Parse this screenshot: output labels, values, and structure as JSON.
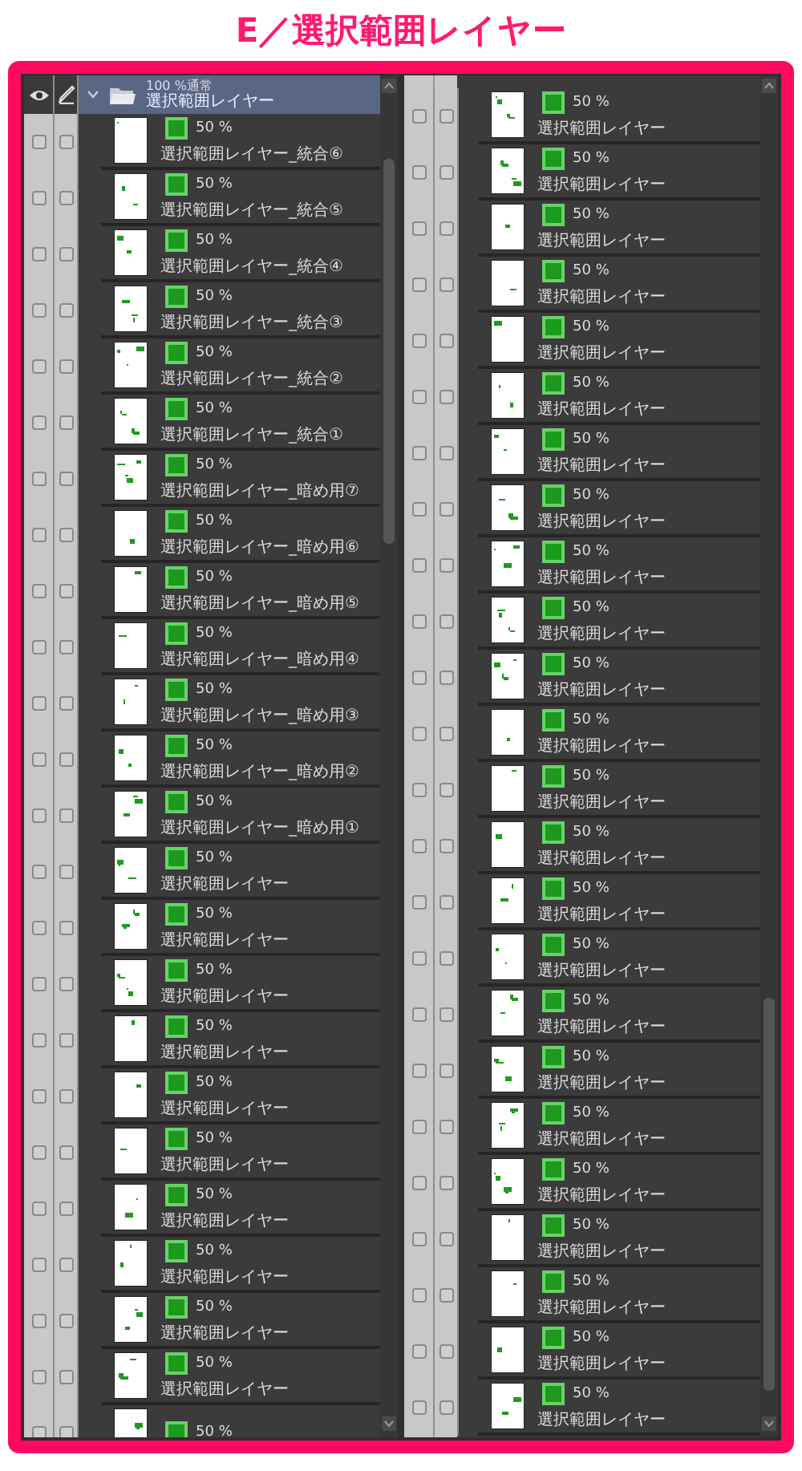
{
  "title": "E／選択範囲レイヤー",
  "panels": [
    {
      "folder": {
        "mode": "100 %通常",
        "name": "選択範囲レイヤー",
        "expanded": true,
        "selected": true
      },
      "layers": [
        {
          "percent": "50 %",
          "name": "選択範囲レイヤー_統合⑥",
          "visible": false,
          "pen": false,
          "selected": false
        },
        {
          "percent": "50 %",
          "name": "選択範囲レイヤー_統合⑤",
          "visible": false,
          "pen": false,
          "selected": false
        },
        {
          "percent": "50 %",
          "name": "選択範囲レイヤー_統合④",
          "visible": false,
          "pen": false,
          "selected": false
        },
        {
          "percent": "50 %",
          "name": "選択範囲レイヤー_統合③",
          "visible": false,
          "pen": false,
          "selected": false
        },
        {
          "percent": "50 %",
          "name": "選択範囲レイヤー_統合②",
          "visible": false,
          "pen": false,
          "selected": false
        },
        {
          "percent": "50 %",
          "name": "選択範囲レイヤー_統合①",
          "visible": false,
          "pen": false,
          "selected": false
        },
        {
          "percent": "50 %",
          "name": "選択範囲レイヤー_暗め用⑦",
          "visible": false,
          "pen": false,
          "selected": false
        },
        {
          "percent": "50 %",
          "name": "選択範囲レイヤー_暗め用⑥",
          "visible": false,
          "pen": false,
          "selected": false
        },
        {
          "percent": "50 %",
          "name": "選択範囲レイヤー_暗め用⑤",
          "visible": false,
          "pen": false,
          "selected": false
        },
        {
          "percent": "50 %",
          "name": "選択範囲レイヤー_暗め用④",
          "visible": false,
          "pen": false,
          "selected": false
        },
        {
          "percent": "50 %",
          "name": "選択範囲レイヤー_暗め用③",
          "visible": false,
          "pen": false,
          "selected": false
        },
        {
          "percent": "50 %",
          "name": "選択範囲レイヤー_暗め用②",
          "visible": false,
          "pen": false,
          "selected": false
        },
        {
          "percent": "50 %",
          "name": "選択範囲レイヤー_暗め用①",
          "visible": false,
          "pen": false,
          "selected": false
        },
        {
          "percent": "50 %",
          "name": "選択範囲レイヤー",
          "visible": false,
          "pen": false,
          "selected": false
        },
        {
          "percent": "50 %",
          "name": "選択範囲レイヤー",
          "visible": false,
          "pen": false,
          "selected": false
        },
        {
          "percent": "50 %",
          "name": "選択範囲レイヤー",
          "visible": false,
          "pen": false,
          "selected": false
        },
        {
          "percent": "50 %",
          "name": "選択範囲レイヤー",
          "visible": false,
          "pen": false,
          "selected": false
        },
        {
          "percent": "50 %",
          "name": "選択範囲レイヤー",
          "visible": false,
          "pen": false,
          "selected": false
        },
        {
          "percent": "50 %",
          "name": "選択範囲レイヤー",
          "visible": false,
          "pen": false,
          "selected": false
        },
        {
          "percent": "50 %",
          "name": "選択範囲レイヤー",
          "visible": false,
          "pen": false,
          "selected": false
        },
        {
          "percent": "50 %",
          "name": "選択範囲レイヤー",
          "visible": false,
          "pen": false,
          "selected": false
        },
        {
          "percent": "50 %",
          "name": "選択範囲レイヤー",
          "visible": false,
          "pen": false,
          "selected": false
        },
        {
          "percent": "50 %",
          "name": "選択範囲レイヤー",
          "visible": false,
          "pen": false,
          "selected": false
        },
        {
          "percent": "50 %",
          "visible": false,
          "pen": false,
          "selected": false
        }
      ]
    },
    {
      "layers": [
        {
          "percent": "50 %",
          "name": "選択範囲レイヤー",
          "visible": false,
          "pen": false,
          "selected": false
        },
        {
          "percent": "50 %",
          "name": "選択範囲レイヤー",
          "visible": false,
          "pen": false,
          "selected": false
        },
        {
          "percent": "50 %",
          "name": "選択範囲レイヤー",
          "visible": false,
          "pen": false,
          "selected": false
        },
        {
          "percent": "50 %",
          "name": "選択範囲レイヤー",
          "visible": false,
          "pen": false,
          "selected": false
        },
        {
          "percent": "50 %",
          "name": "選択範囲レイヤー",
          "visible": false,
          "pen": false,
          "selected": false
        },
        {
          "percent": "50 %",
          "name": "選択範囲レイヤー",
          "visible": false,
          "pen": false,
          "selected": false
        },
        {
          "percent": "50 %",
          "name": "選択範囲レイヤー",
          "visible": false,
          "pen": false,
          "selected": false
        },
        {
          "percent": "50 %",
          "name": "選択範囲レイヤー",
          "visible": false,
          "pen": false,
          "selected": false
        },
        {
          "percent": "50 %",
          "name": "選択範囲レイヤー",
          "visible": false,
          "pen": false,
          "selected": false
        },
        {
          "percent": "50 %",
          "name": "選択範囲レイヤー",
          "visible": false,
          "pen": false,
          "selected": false
        },
        {
          "percent": "50 %",
          "name": "選択範囲レイヤー",
          "visible": false,
          "pen": false,
          "selected": false
        },
        {
          "percent": "50 %",
          "name": "選択範囲レイヤー",
          "visible": false,
          "pen": false,
          "selected": false
        },
        {
          "percent": "50 %",
          "name": "選択範囲レイヤー",
          "visible": false,
          "pen": false,
          "selected": false
        },
        {
          "percent": "50 %",
          "name": "選択範囲レイヤー",
          "visible": false,
          "pen": false,
          "selected": false
        },
        {
          "percent": "50 %",
          "name": "選択範囲レイヤー",
          "visible": false,
          "pen": false,
          "selected": false
        },
        {
          "percent": "50 %",
          "name": "選択範囲レイヤー",
          "visible": false,
          "pen": false,
          "selected": false
        },
        {
          "percent": "50 %",
          "name": "選択範囲レイヤー",
          "visible": false,
          "pen": false,
          "selected": false
        },
        {
          "percent": "50 %",
          "name": "選択範囲レイヤー",
          "visible": false,
          "pen": false,
          "selected": false
        },
        {
          "percent": "50 %",
          "name": "選択範囲レイヤー",
          "visible": false,
          "pen": false,
          "selected": false
        },
        {
          "percent": "50 %",
          "name": "選択範囲レイヤー",
          "visible": false,
          "pen": false,
          "selected": false
        },
        {
          "percent": "50 %",
          "name": "選択範囲レイヤー",
          "visible": false,
          "pen": false,
          "selected": false
        },
        {
          "percent": "50 %",
          "name": "選択範囲レイヤー",
          "visible": false,
          "pen": false,
          "selected": false
        },
        {
          "percent": "50 %",
          "name": "選択範囲レイヤー",
          "visible": false,
          "pen": false,
          "selected": false
        },
        {
          "percent": "50 %",
          "name": "選択範囲レイヤー",
          "visible": false,
          "pen": false,
          "selected": false
        }
      ]
    }
  ]
}
